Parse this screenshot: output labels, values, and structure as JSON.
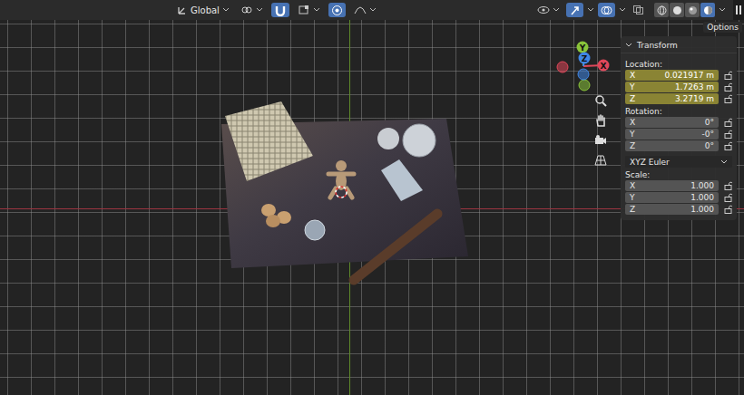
{
  "header": {
    "orientation": "Global",
    "snap": true,
    "proportional_editing": true,
    "overlays": true,
    "xray": false,
    "shading_modes": [
      {
        "selected": false
      },
      {
        "selected": false
      },
      {
        "selected": false
      },
      {
        "selected": true
      }
    ]
  },
  "gizmo": {
    "axes": [
      {
        "label": "X",
        "color": "#e0475a"
      },
      {
        "label": "Y",
        "color": "#8ac43a"
      },
      {
        "label": "Z",
        "color": "#3f86e6"
      }
    ]
  },
  "sidebar": {
    "options": "Options",
    "panel": {
      "title": "Transform",
      "expanded": true,
      "sections": [
        {
          "label": "Location:",
          "fields": [
            {
              "axis": "X",
              "value": "0.021917 m",
              "keyed": true,
              "locked": false
            },
            {
              "axis": "Y",
              "value": "1.7263 m",
              "keyed": true,
              "locked": false
            },
            {
              "axis": "Z",
              "value": "3.2719 m",
              "keyed": true,
              "locked": false
            }
          ]
        },
        {
          "label": "Rotation:",
          "fields": [
            {
              "axis": "X",
              "value": "0°",
              "keyed": false,
              "locked": false
            },
            {
              "axis": "Y",
              "value": "-0°",
              "keyed": false,
              "locked": false
            },
            {
              "axis": "Z",
              "value": "0°",
              "keyed": false,
              "locked": false
            }
          ],
          "mode": "XYZ Euler"
        },
        {
          "label": "Scale:",
          "fields": [
            {
              "axis": "X",
              "value": "1.000",
              "keyed": false,
              "locked": false
            },
            {
              "axis": "Y",
              "value": "1.000",
              "keyed": false,
              "locked": false
            },
            {
              "axis": "Z",
              "value": "1.000",
              "keyed": false,
              "locked": false
            }
          ]
        }
      ]
    }
  }
}
